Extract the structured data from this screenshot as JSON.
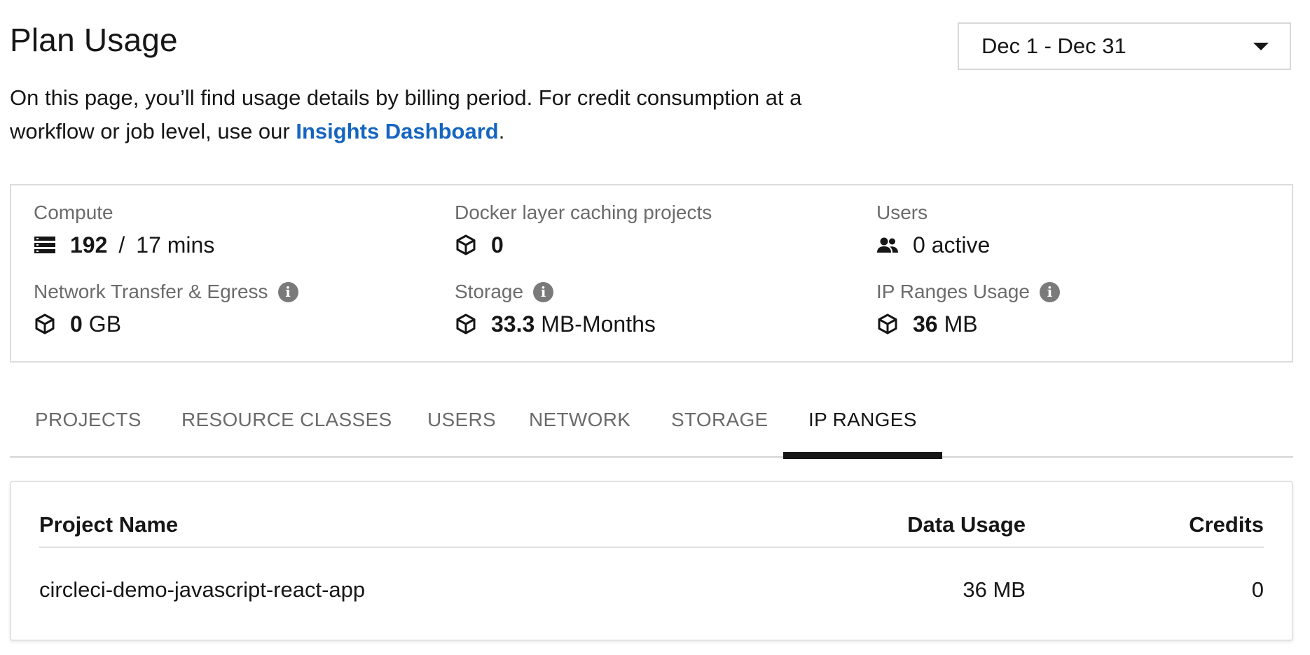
{
  "header": {
    "title": "Plan Usage",
    "intro_text": "On this page, you’ll find usage details by billing period. For credit consumption at a workflow or job level, use our ",
    "intro_link": "Insights Dashboard",
    "intro_suffix": "."
  },
  "date_range": {
    "value": "Dec 1 - Dec 31",
    "icon": "caret-down-icon"
  },
  "summary": {
    "compute": {
      "label": "Compute",
      "primary": "192",
      "separator": "/",
      "secondary": "17 mins",
      "icon": "server-stack-icon"
    },
    "docker": {
      "label": "Docker layer caching projects",
      "value": "0",
      "icon": "cube-icon"
    },
    "users": {
      "label": "Users",
      "value": "0 active",
      "icon": "people-icon"
    },
    "network": {
      "label": "Network Transfer & Egress",
      "value": "0",
      "unit": "GB",
      "icon": "cube-icon",
      "info": "i"
    },
    "storage": {
      "label": "Storage",
      "value": "33.3",
      "unit": "MB-Months",
      "icon": "cube-icon",
      "info": "i"
    },
    "ip_ranges": {
      "label": "IP Ranges Usage",
      "value": "36",
      "unit": "MB",
      "icon": "cube-icon",
      "info": "i"
    }
  },
  "tabs": [
    {
      "label": "PROJECTS",
      "active": false
    },
    {
      "label": "RESOURCE CLASSES",
      "active": false
    },
    {
      "label": "USERS",
      "active": false
    },
    {
      "label": "NETWORK",
      "active": false
    },
    {
      "label": "STORAGE",
      "active": false
    },
    {
      "label": "IP RANGES",
      "active": true
    }
  ],
  "table": {
    "columns": [
      "Project Name",
      "Data Usage",
      "Credits"
    ],
    "rows": [
      {
        "project": "circleci-demo-javascript-react-app",
        "data_usage": "36 MB",
        "credits": "0"
      }
    ]
  },
  "colors": {
    "link": "#1565c0",
    "text": "#161616",
    "muted": "#6b6b6b",
    "border": "#dcdcdc"
  }
}
